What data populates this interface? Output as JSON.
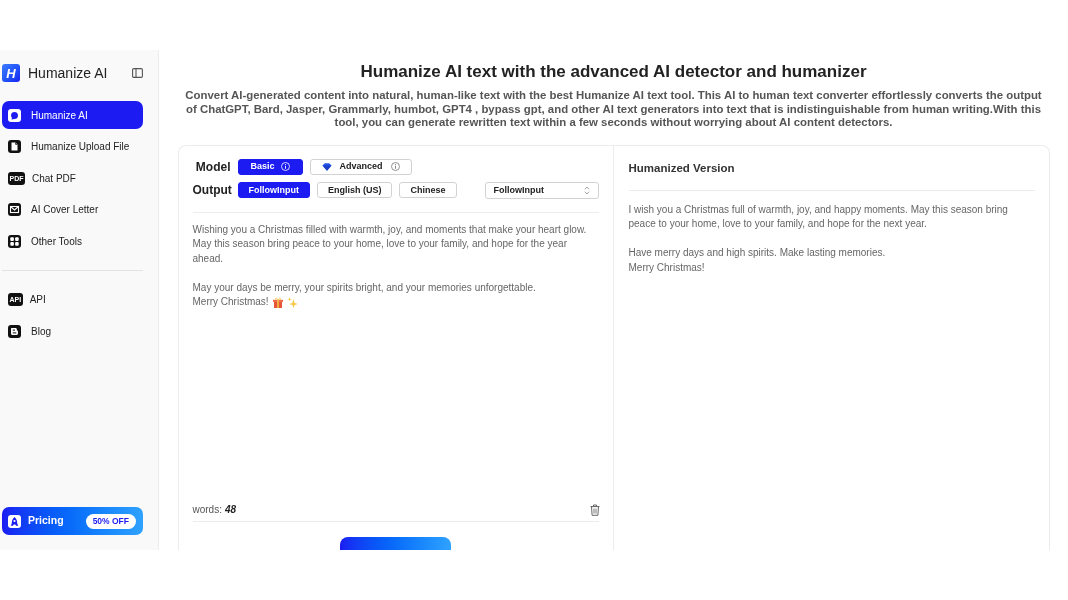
{
  "sidebar": {
    "logo": {
      "mark": "H",
      "name": "Humanize AI"
    },
    "items": [
      {
        "label": "Humanize AI",
        "selected": true
      },
      {
        "label": "Humanize Upload File",
        "selected": false
      },
      {
        "label": "Chat PDF",
        "selected": false,
        "icon_text": "PDF"
      },
      {
        "label": "AI Cover Letter",
        "selected": false
      },
      {
        "label": "Other Tools",
        "selected": false
      }
    ],
    "secondary_items": [
      {
        "label": "API",
        "selected": false,
        "icon_text": "API"
      },
      {
        "label": "Blog",
        "selected": false
      }
    ],
    "pricing": {
      "label": "Pricing",
      "badge": "50% OFF"
    }
  },
  "header": {
    "title": "Humanize AI text with the advanced AI detector and humanizer",
    "description": "Convert AI-generated content into natural, human-like text with the best Humanize AI text tool. This AI to human text converter effortlessly converts the output of ChatGPT, Bard, Jasper, Grammarly, humbot, GPT4 , bypass gpt, and other AI text generators into text that is indistinguishable from human writing.With this tool, you can generate rewritten text within a few seconds without worrying about AI content detectors."
  },
  "editor": {
    "model": {
      "label": "Model",
      "options": [
        {
          "label": "Basic",
          "selected": true,
          "kind": "basic"
        },
        {
          "label": "Advanced",
          "selected": false,
          "kind": "premium"
        }
      ]
    },
    "output": {
      "label": "Output",
      "options": [
        {
          "label": "FollowInput",
          "selected": true
        },
        {
          "label": "English (US)",
          "selected": false
        },
        {
          "label": "Chinese",
          "selected": false
        }
      ],
      "select": {
        "value": "FollowInput"
      }
    },
    "input": {
      "paragraphs": [
        [
          "Wishing you a Christmas filled with warmth, joy, and moments that make your heart glow. May this season bring peace to your home, love to your family, and hope for the year ahead."
        ],
        [
          "May your days be merry, your spirits bright, and your memories unforgettable.",
          "Merry Christmas!"
        ]
      ]
    },
    "word_count": {
      "label": "words:",
      "value": "48"
    }
  },
  "result": {
    "title": "Humanized Version",
    "paragraphs": [
      [
        "I wish you a Christmas full of warmth, joy, and happy moments. May this season bring peace to your home, love to your family, and hope for the next year."
      ],
      [
        "Have merry days and high spirits. Make lasting memories.",
        "Merry Christmas!"
      ]
    ]
  }
}
